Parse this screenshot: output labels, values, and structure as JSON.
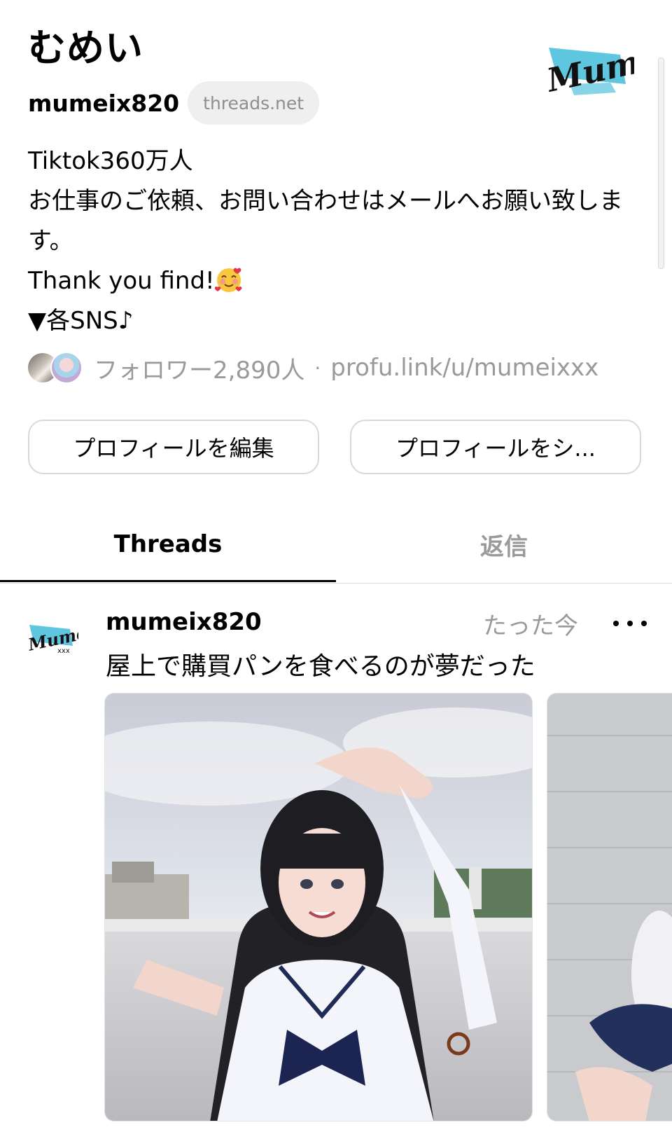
{
  "profile": {
    "display_name": "むめい",
    "handle": "mumeix820",
    "domain_pill": "threads.net",
    "avatar_logo_text": "Mumei xxx",
    "bio_lines": [
      "Tiktok360万人",
      "お仕事のご依頼、お問い合わせはメールへお願い致します。",
      "Thank you find!",
      "▼各SNS♪"
    ],
    "bio_emoji": "smiling-face-with-hearts-emoji",
    "followers_text": "フォロワー2,890人",
    "separator": "·",
    "link": "profu.link/u/mumeixxx"
  },
  "buttons": {
    "edit": "プロフィールを編集",
    "share": "プロフィールをシ..."
  },
  "tabs": [
    {
      "label": "Threads",
      "active": true
    },
    {
      "label": "返信",
      "active": false
    }
  ],
  "post": {
    "username": "mumeix820",
    "time": "たった今",
    "text": "屋上で購買パンを食べるのが夢だった",
    "photo_description_icon": "photo-selfie",
    "image_count": 2
  },
  "colors": {
    "accent_blue": "#5fc6df",
    "muted_text": "#9a9a9a",
    "pill_bg": "#efefef"
  }
}
